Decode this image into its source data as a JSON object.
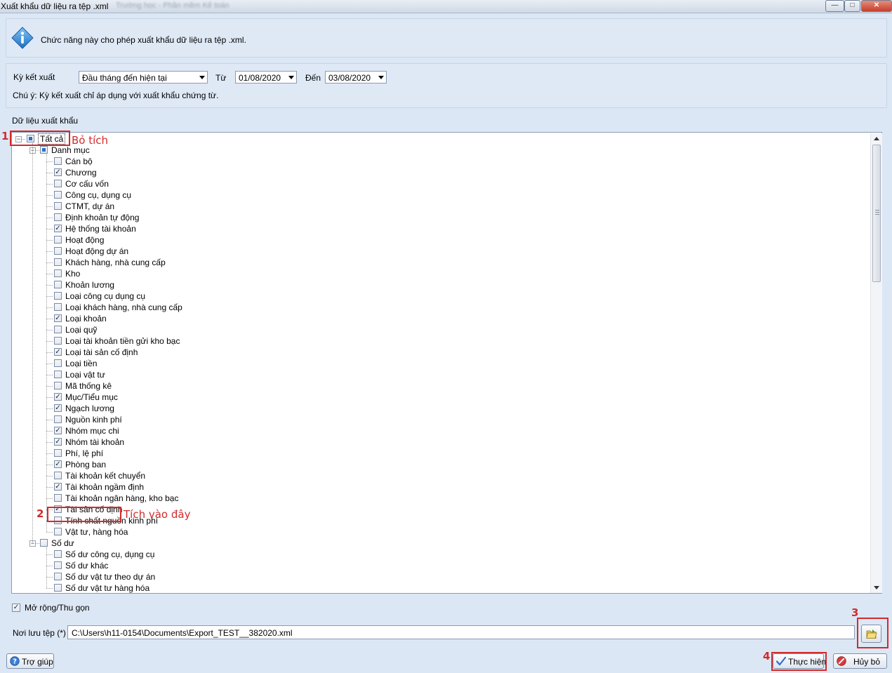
{
  "window": {
    "title": "Xuất khẩu dữ liệu ra tệp .xml",
    "title_blurred": "Trường học - Phần mềm Kế toán",
    "controls": [
      "minimize",
      "maximize",
      "close"
    ]
  },
  "info": {
    "icon": "info-icon",
    "text": "Chức năng này cho phép xuất khẩu dữ liệu ra tệp .xml."
  },
  "period": {
    "label": "Kỳ kết xuất",
    "selected": "Đầu tháng đến hiện tại",
    "from_label": "Từ",
    "from_value": "01/08/2020",
    "to_label": "Đến",
    "to_value": "03/08/2020",
    "note": "Chú ý: Kỳ kết xuất chỉ áp dụng với xuất khẩu chứng từ."
  },
  "export_section_label": "Dữ liệu xuất khẩu",
  "tree": {
    "root": {
      "label": "Tất cả",
      "state": "partial",
      "expanded": true
    },
    "groups": [
      {
        "label": "Danh mục",
        "state": "partial",
        "expanded": true,
        "items": [
          {
            "label": "Cán bộ",
            "checked": false
          },
          {
            "label": "Chương",
            "checked": true
          },
          {
            "label": "Cơ cấu vốn",
            "checked": false
          },
          {
            "label": "Công cụ, dụng cụ",
            "checked": false
          },
          {
            "label": "CTMT, dự án",
            "checked": false
          },
          {
            "label": "Định khoản tự động",
            "checked": false
          },
          {
            "label": "Hệ thống tài khoản",
            "checked": true
          },
          {
            "label": "Hoạt động",
            "checked": false
          },
          {
            "label": "Hoạt động dự án",
            "checked": false
          },
          {
            "label": "Khách hàng, nhà cung cấp",
            "checked": false
          },
          {
            "label": "Kho",
            "checked": false
          },
          {
            "label": "Khoản lương",
            "checked": false
          },
          {
            "label": "Loại công cụ dụng cụ",
            "checked": false
          },
          {
            "label": "Loại khách hàng, nhà cung cấp",
            "checked": false
          },
          {
            "label": "Loại khoản",
            "checked": true
          },
          {
            "label": "Loại quỹ",
            "checked": false
          },
          {
            "label": "Loại tài khoản tiền gửi kho bạc",
            "checked": false
          },
          {
            "label": "Loại tài sản cố định",
            "checked": true
          },
          {
            "label": "Loại tiền",
            "checked": false
          },
          {
            "label": "Loại vật tư",
            "checked": false
          },
          {
            "label": "Mã thống kê",
            "checked": false
          },
          {
            "label": "Mục/Tiểu mục",
            "checked": true
          },
          {
            "label": "Ngạch lương",
            "checked": true
          },
          {
            "label": "Nguồn kinh phí",
            "checked": false
          },
          {
            "label": "Nhóm mục chi",
            "checked": true
          },
          {
            "label": "Nhóm tài khoản",
            "checked": true
          },
          {
            "label": "Phí, lệ phí",
            "checked": false
          },
          {
            "label": "Phòng ban",
            "checked": true
          },
          {
            "label": "Tài khoản kết chuyển",
            "checked": false
          },
          {
            "label": "Tài khoản ngầm định",
            "checked": true
          },
          {
            "label": "Tài khoản ngân hàng, kho bạc",
            "checked": false
          },
          {
            "label": "Tài sản cố định",
            "checked": true
          },
          {
            "label": "Tính chất nguồn kinh phí",
            "checked": false
          },
          {
            "label": "Vật tư, hàng hóa",
            "checked": false
          }
        ]
      },
      {
        "label": "Số dư",
        "state": "unchecked",
        "expanded": true,
        "items": [
          {
            "label": "Số dư công cụ, dụng cụ",
            "checked": false
          },
          {
            "label": "Số dư khác",
            "checked": false
          },
          {
            "label": "Số dư vật tư theo dự án",
            "checked": false
          },
          {
            "label": "Số dư vật tư hàng hóa",
            "checked": false
          }
        ]
      }
    ]
  },
  "expand_collapse": {
    "label": "Mở rộng/Thu gọn",
    "checked": true
  },
  "save_path": {
    "label": "Nơi lưu tệp (*)",
    "value": "C:\\Users\\h11-0154\\Documents\\Export_TEST__382020.xml",
    "browse_icon": "folder-browse-icon"
  },
  "buttons": {
    "help": "Trợ giúp",
    "execute": "Thực hiện",
    "cancel": "Hủy bỏ"
  },
  "annotations": {
    "step1_number": "1",
    "step1_text": "Bỏ tích",
    "step2_number": "2",
    "step2_text": "Tích vào đây",
    "step3_number": "3",
    "step4_number": "4",
    "color": "#d22b2b"
  }
}
